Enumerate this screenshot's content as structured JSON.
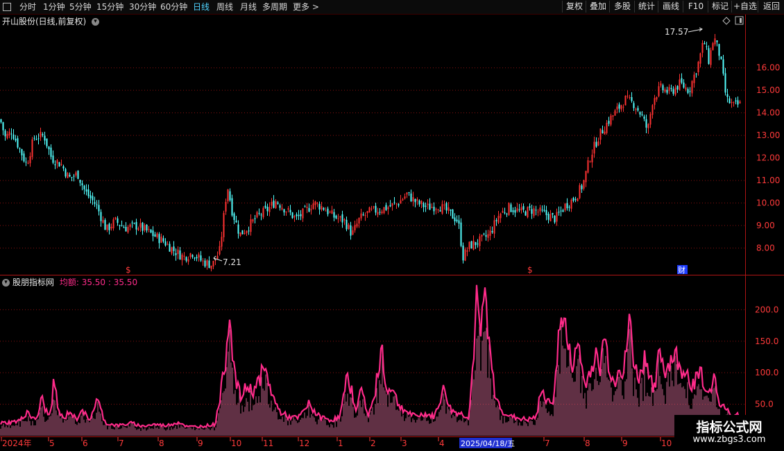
{
  "toolbar": {
    "left_icon": "window-icon",
    "periods": [
      "分时",
      "1分钟",
      "5分钟",
      "15分钟",
      "30分钟",
      "60分钟",
      "日线",
      "周线",
      "月线",
      "多周期",
      "更多 >"
    ],
    "active_period": "日线",
    "buttons": [
      "复权",
      "叠加",
      "多股",
      "统计",
      "画线",
      "F10",
      "标记",
      "+自选",
      "返回"
    ]
  },
  "main_title": "开山股份(日线,前复权)",
  "indicator": {
    "name": "股朋指标网",
    "label": "均额: 35.50 : 35.50"
  },
  "markers": {
    "high": "17.57",
    "low": "7.21",
    "s1": "$",
    "s2": "$",
    "cai": "财"
  },
  "date_badge": "2025/04/18/五",
  "x_labels": [
    "2024年",
    "5",
    "6",
    "7",
    "8",
    "9",
    "10",
    "11",
    "12",
    "1",
    "2",
    "3",
    "4",
    "7",
    "8",
    "9",
    "10"
  ],
  "watermark": {
    "line1": "指标公式网",
    "line2": "www.zbgs3.com"
  },
  "colors": {
    "up": "#ff3232",
    "down": "#54ffff",
    "indicator": "#ff2b8a",
    "grid": "#8a1010",
    "axis": "#ff3a3a"
  },
  "chart_data": [
    {
      "type": "candlestick",
      "title": "开山股份(日线,前复权)",
      "y_ticks": [
        8.0,
        9.0,
        10.0,
        11.0,
        12.0,
        13.0,
        14.0,
        15.0,
        16.0
      ],
      "ylim": [
        7.0,
        17.9
      ],
      "grid": true,
      "anchors": [
        [
          "2024-04-01",
          13.7
        ],
        [
          "2024-04-05",
          12.9
        ],
        [
          "2024-04-10",
          13.2
        ],
        [
          "2024-04-15",
          12.6
        ],
        [
          "2024-04-22",
          11.7
        ],
        [
          "2024-04-28",
          12.9
        ],
        [
          "2024-05-06",
          13.0
        ],
        [
          "2024-05-12",
          12.0
        ],
        [
          "2024-05-20",
          11.7
        ],
        [
          "2024-05-26",
          11.1
        ],
        [
          "2024-06-02",
          11.3
        ],
        [
          "2024-06-08",
          10.5
        ],
        [
          "2024-06-17",
          9.9
        ],
        [
          "2024-06-25",
          8.8
        ],
        [
          "2024-07-02",
          9.2
        ],
        [
          "2024-07-10",
          8.9
        ],
        [
          "2024-07-20",
          9.0
        ],
        [
          "2024-08-01",
          8.6
        ],
        [
          "2024-08-10",
          8.3
        ],
        [
          "2024-08-18",
          7.9
        ],
        [
          "2024-08-26",
          7.6
        ],
        [
          "2024-09-02",
          7.8
        ],
        [
          "2024-09-10",
          7.4
        ],
        [
          "2024-09-18",
          7.25
        ],
        [
          "2024-09-24",
          7.9
        ],
        [
          "2024-09-30",
          10.8
        ],
        [
          "2024-10-04",
          9.6
        ],
        [
          "2024-10-10",
          8.6
        ],
        [
          "2024-10-16",
          8.9
        ],
        [
          "2024-10-24",
          9.4
        ],
        [
          "2024-11-01",
          9.7
        ],
        [
          "2024-11-08",
          10.1
        ],
        [
          "2024-11-16",
          9.7
        ],
        [
          "2024-11-24",
          9.3
        ],
        [
          "2024-12-01",
          9.6
        ],
        [
          "2024-12-08",
          10.0
        ],
        [
          "2024-12-16",
          9.8
        ],
        [
          "2024-12-24",
          9.4
        ],
        [
          "2025-01-02",
          9.2
        ],
        [
          "2025-01-08",
          8.6
        ],
        [
          "2025-01-14",
          9.3
        ],
        [
          "2025-01-22",
          9.6
        ],
        [
          "2025-02-05",
          9.8
        ],
        [
          "2025-02-14",
          10.0
        ],
        [
          "2025-02-21",
          10.4
        ],
        [
          "2025-03-01",
          10.0
        ],
        [
          "2025-03-10",
          9.8
        ],
        [
          "2025-03-18",
          9.9
        ],
        [
          "2025-03-26",
          9.6
        ],
        [
          "2025-04-03",
          9.2
        ],
        [
          "2025-04-07",
          7.6
        ],
        [
          "2025-04-12",
          8.1
        ],
        [
          "2025-04-20",
          8.3
        ],
        [
          "2025-04-28",
          8.6
        ],
        [
          "2025-05-06",
          9.5
        ],
        [
          "2025-05-14",
          9.8
        ],
        [
          "2025-05-24",
          9.6
        ],
        [
          "2025-06-02",
          9.7
        ],
        [
          "2025-06-12",
          9.5
        ],
        [
          "2025-06-20",
          9.3
        ],
        [
          "2025-06-28",
          9.9
        ],
        [
          "2025-07-05",
          10.2
        ],
        [
          "2025-07-12",
          10.8
        ],
        [
          "2025-07-18",
          12.1
        ],
        [
          "2025-07-25",
          13.0
        ],
        [
          "2025-08-01",
          13.6
        ],
        [
          "2025-08-08",
          14.1
        ],
        [
          "2025-08-15",
          14.6
        ],
        [
          "2025-08-22",
          14.4
        ],
        [
          "2025-08-28",
          13.9
        ],
        [
          "2025-09-02",
          13.2
        ],
        [
          "2025-09-06",
          14.6
        ],
        [
          "2025-09-12",
          15.1
        ],
        [
          "2025-09-20",
          14.9
        ],
        [
          "2025-09-28",
          15.3
        ],
        [
          "2025-10-05",
          15.0
        ],
        [
          "2025-10-12",
          16.1
        ],
        [
          "2025-10-17",
          17.2
        ],
        [
          "2025-10-21",
          16.3
        ],
        [
          "2025-10-25",
          17.4
        ],
        [
          "2025-10-30",
          16.5
        ],
        [
          "2025-11-04",
          14.6
        ],
        [
          "2025-11-10",
          14.3
        ],
        [
          "2025-11-16",
          14.4
        ]
      ]
    },
    {
      "type": "bar",
      "title": "股朋指标网",
      "y_ticks": [
        50.0,
        100.0,
        150.0,
        200.0
      ],
      "ylim": [
        0,
        240
      ],
      "grid": true,
      "anchors": [
        [
          0,
          20
        ],
        [
          20,
          22
        ],
        [
          30,
          25
        ],
        [
          40,
          40
        ],
        [
          48,
          25
        ],
        [
          54,
          30
        ],
        [
          60,
          60
        ],
        [
          66,
          40
        ],
        [
          72,
          30
        ],
        [
          78,
          88
        ],
        [
          84,
          40
        ],
        [
          92,
          25
        ],
        [
          100,
          40
        ],
        [
          110,
          25
        ],
        [
          118,
          45
        ],
        [
          128,
          22
        ],
        [
          140,
          58
        ],
        [
          152,
          20
        ],
        [
          170,
          16
        ],
        [
          190,
          20
        ],
        [
          205,
          15
        ],
        [
          222,
          18
        ],
        [
          240,
          16
        ],
        [
          258,
          22
        ],
        [
          270,
          14
        ],
        [
          290,
          15
        ],
        [
          310,
          18
        ],
        [
          320,
          80
        ],
        [
          326,
          130
        ],
        [
          331,
          208
        ],
        [
          336,
          120
        ],
        [
          341,
          80
        ],
        [
          348,
          60
        ],
        [
          356,
          80
        ],
        [
          364,
          70
        ],
        [
          372,
          85
        ],
        [
          380,
          105
        ],
        [
          386,
          90
        ],
        [
          394,
          60
        ],
        [
          402,
          40
        ],
        [
          415,
          30
        ],
        [
          430,
          28
        ],
        [
          445,
          50
        ],
        [
          460,
          30
        ],
        [
          478,
          25
        ],
        [
          490,
          30
        ],
        [
          500,
          90
        ],
        [
          506,
          75
        ],
        [
          514,
          40
        ],
        [
          522,
          80
        ],
        [
          530,
          30
        ],
        [
          540,
          60
        ],
        [
          550,
          148
        ],
        [
          556,
          70
        ],
        [
          564,
          80
        ],
        [
          574,
          50
        ],
        [
          584,
          40
        ],
        [
          598,
          30
        ],
        [
          612,
          35
        ],
        [
          626,
          30
        ],
        [
          640,
          75
        ],
        [
          650,
          40
        ],
        [
          664,
          35
        ],
        [
          676,
          30
        ],
        [
          684,
          150
        ],
        [
          688,
          230
        ],
        [
          692,
          140
        ],
        [
          696,
          200
        ],
        [
          700,
          230
        ],
        [
          706,
          130
        ],
        [
          714,
          60
        ],
        [
          724,
          40
        ],
        [
          736,
          30
        ],
        [
          748,
          28
        ],
        [
          760,
          25
        ],
        [
          774,
          30
        ],
        [
          780,
          80
        ],
        [
          788,
          50
        ],
        [
          798,
          60
        ],
        [
          805,
          150
        ],
        [
          812,
          200
        ],
        [
          818,
          140
        ],
        [
          826,
          110
        ],
        [
          834,
          150
        ],
        [
          842,
          80
        ],
        [
          850,
          100
        ],
        [
          858,
          130
        ],
        [
          864,
          100
        ],
        [
          871,
          160
        ],
        [
          878,
          110
        ],
        [
          886,
          80
        ],
        [
          892,
          120
        ],
        [
          898,
          90
        ],
        [
          908,
          185
        ],
        [
          914,
          110
        ],
        [
          922,
          90
        ],
        [
          930,
          130
        ],
        [
          938,
          90
        ],
        [
          944,
          70
        ],
        [
          951,
          140
        ],
        [
          958,
          100
        ],
        [
          966,
          120
        ],
        [
          974,
          130
        ],
        [
          980,
          100
        ],
        [
          988,
          110
        ],
        [
          996,
          80
        ],
        [
          1004,
          90
        ],
        [
          1010,
          110
        ],
        [
          1018,
          60
        ],
        [
          1024,
          80
        ],
        [
          1030,
          90
        ],
        [
          1038,
          40
        ],
        [
          1046,
          50
        ],
        [
          1054,
          30
        ],
        [
          1060,
          35
        ],
        [
          1072,
          30
        ]
      ]
    }
  ]
}
